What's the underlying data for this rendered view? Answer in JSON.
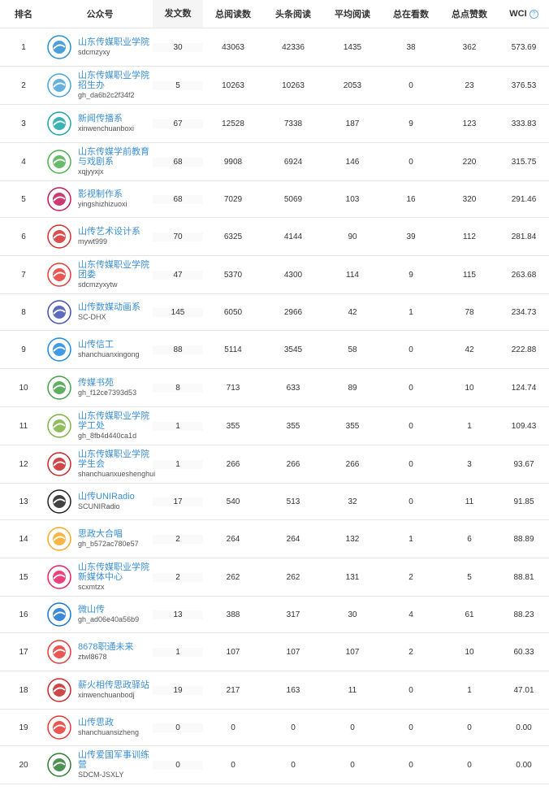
{
  "header": {
    "rank": "排名",
    "account": "公众号",
    "posts": "发文数",
    "total_reads": "总阅读数",
    "headline_reads": "头条阅读",
    "avg_reads": "平均阅读",
    "total_looking": "总在看数",
    "total_likes": "总点赞数",
    "wci": "WCI",
    "help_icon": "?"
  },
  "rows": [
    {
      "rank": "1",
      "name": "山东传媒职业学院",
      "id": "sdcmzyxy",
      "posts": "30",
      "total": "43063",
      "headline": "42336",
      "avg": "1435",
      "looking": "38",
      "likes": "362",
      "wci": "573.69",
      "color": "#2a8fd0"
    },
    {
      "rank": "2",
      "name": "山东传媒职业学院招生办",
      "id": "gh_da6b2c2f34f2",
      "posts": "5",
      "total": "10263",
      "headline": "10263",
      "avg": "2053",
      "looking": "0",
      "likes": "23",
      "wci": "376.53",
      "color": "#4aa3d8"
    },
    {
      "rank": "3",
      "name": "新闻传播系",
      "id": "xinwenchuanboxi",
      "posts": "67",
      "total": "12528",
      "headline": "7338",
      "avg": "187",
      "looking": "9",
      "likes": "123",
      "wci": "333.83",
      "color": "#1aa6a6"
    },
    {
      "rank": "4",
      "name": "山东传媒学前教育与戏剧系",
      "id": "xqjyyxjx",
      "posts": "68",
      "total": "9908",
      "headline": "6924",
      "avg": "146",
      "looking": "0",
      "likes": "220",
      "wci": "315.75",
      "color": "#4caf50"
    },
    {
      "rank": "5",
      "name": "影视制作系",
      "id": "yingshizhizuoxi",
      "posts": "68",
      "total": "7029",
      "headline": "5069",
      "avg": "103",
      "looking": "16",
      "likes": "320",
      "wci": "291.46",
      "color": "#c2185b"
    },
    {
      "rank": "6",
      "name": "山传艺术设计系",
      "id": "mywt999",
      "posts": "70",
      "total": "6325",
      "headline": "4144",
      "avg": "90",
      "looking": "39",
      "likes": "112",
      "wci": "281.84",
      "color": "#d32f2f"
    },
    {
      "rank": "7",
      "name": "山东传媒职业学院团委",
      "id": "sdcmzyxytw",
      "posts": "47",
      "total": "5370",
      "headline": "4300",
      "avg": "114",
      "looking": "9",
      "likes": "115",
      "wci": "263.68",
      "color": "#e53935"
    },
    {
      "rank": "8",
      "name": "山传数媒动画系",
      "id": "SC-DHX",
      "posts": "145",
      "total": "6050",
      "headline": "2966",
      "avg": "42",
      "looking": "1",
      "likes": "78",
      "wci": "234.73",
      "color": "#3f51b5"
    },
    {
      "rank": "9",
      "name": "山传信工",
      "id": "shanchuanxingong",
      "posts": "88",
      "total": "5114",
      "headline": "3545",
      "avg": "58",
      "looking": "0",
      "likes": "42",
      "wci": "222.88",
      "color": "#1e88e5"
    },
    {
      "rank": "10",
      "name": "传媒书苑",
      "id": "gh_f12ce7393d53",
      "posts": "8",
      "total": "713",
      "headline": "633",
      "avg": "89",
      "looking": "0",
      "likes": "10",
      "wci": "124.74",
      "color": "#43a047"
    },
    {
      "rank": "11",
      "name": "山东传媒职业学院学工处",
      "id": "gh_8fb4d440ca1d",
      "posts": "1",
      "total": "355",
      "headline": "355",
      "avg": "355",
      "looking": "0",
      "likes": "1",
      "wci": "109.43",
      "color": "#7cb342"
    },
    {
      "rank": "12",
      "name": "山东传媒职业学院学生会",
      "id": "shanchuanxueshenghui",
      "posts": "1",
      "total": "266",
      "headline": "266",
      "avg": "266",
      "looking": "0",
      "likes": "3",
      "wci": "93.67",
      "color": "#c62828"
    },
    {
      "rank": "13",
      "name": "山传UNIRadio",
      "id": "SCUNIRadio",
      "posts": "17",
      "total": "540",
      "headline": "513",
      "avg": "32",
      "looking": "0",
      "likes": "11",
      "wci": "91.85",
      "color": "#212121"
    },
    {
      "rank": "14",
      "name": "思政大合唱",
      "id": "gh_b572ac780e57",
      "posts": "2",
      "total": "264",
      "headline": "264",
      "avg": "132",
      "looking": "1",
      "likes": "6",
      "wci": "88.89",
      "color": "#f9a825"
    },
    {
      "rank": "15",
      "name": "山东传媒职业学院新媒体中心",
      "id": "scxmtzx",
      "posts": "2",
      "total": "262",
      "headline": "262",
      "avg": "131",
      "looking": "2",
      "likes": "5",
      "wci": "88.81",
      "color": "#e91e63"
    },
    {
      "rank": "16",
      "name": "微山传",
      "id": "gh_ad06e40a56b9",
      "posts": "13",
      "total": "388",
      "headline": "317",
      "avg": "30",
      "looking": "4",
      "likes": "61",
      "wci": "88.23",
      "color": "#1976d2"
    },
    {
      "rank": "17",
      "name": "8678职通未来",
      "id": "ztwl8678",
      "posts": "1",
      "total": "107",
      "headline": "107",
      "avg": "107",
      "looking": "2",
      "likes": "10",
      "wci": "60.33",
      "color": "#e53935"
    },
    {
      "rank": "18",
      "name": "薪火相传思政驿站",
      "id": "xinwenchuanbodj",
      "posts": "19",
      "total": "217",
      "headline": "163",
      "avg": "11",
      "looking": "0",
      "likes": "1",
      "wci": "47.01",
      "color": "#c62828"
    },
    {
      "rank": "19",
      "name": "山传思政",
      "id": "shanchuansizheng",
      "posts": "0",
      "total": "0",
      "headline": "0",
      "avg": "0",
      "looking": "0",
      "likes": "0",
      "wci": "0.00",
      "color": "#e53935"
    },
    {
      "rank": "20",
      "name": "山传爱国军事训练营",
      "id": "SDCM-JSXLY",
      "posts": "0",
      "total": "0",
      "headline": "0",
      "avg": "0",
      "looking": "0",
      "likes": "0",
      "wci": "0.00",
      "color": "#2e7d32"
    }
  ]
}
